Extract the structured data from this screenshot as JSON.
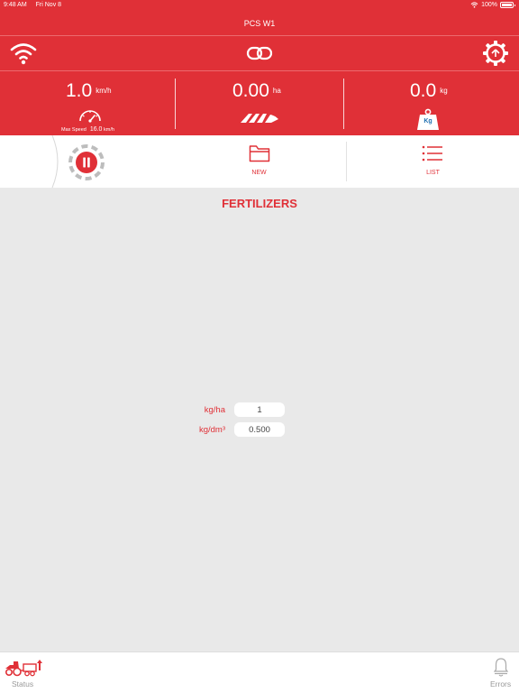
{
  "status_bar": {
    "time": "9:48 AM",
    "date": "Fri Nov 8",
    "battery": "100%"
  },
  "nav": {
    "title": "PCS W1"
  },
  "readouts": {
    "speed": {
      "value": "1.0",
      "unit": "km/h",
      "max_label": "Max Speed",
      "max_value": "16.0",
      "max_unit": "km/h"
    },
    "area": {
      "value": "0.00",
      "unit": "ha"
    },
    "weight": {
      "value": "0.0",
      "unit": "kg",
      "badge": "Kg"
    }
  },
  "actions": {
    "new_label": "NEW",
    "list_label": "LIST"
  },
  "main": {
    "title": "FERTILIZERS",
    "fields": [
      {
        "label": "kg/ha",
        "value": "1"
      },
      {
        "label": "kg/dm³",
        "value": "0.500"
      }
    ]
  },
  "tabbar": {
    "status_label": "Status",
    "errors_label": "Errors"
  },
  "colors": {
    "brand_red": "#e03037",
    "background": "#e9e9e9"
  }
}
